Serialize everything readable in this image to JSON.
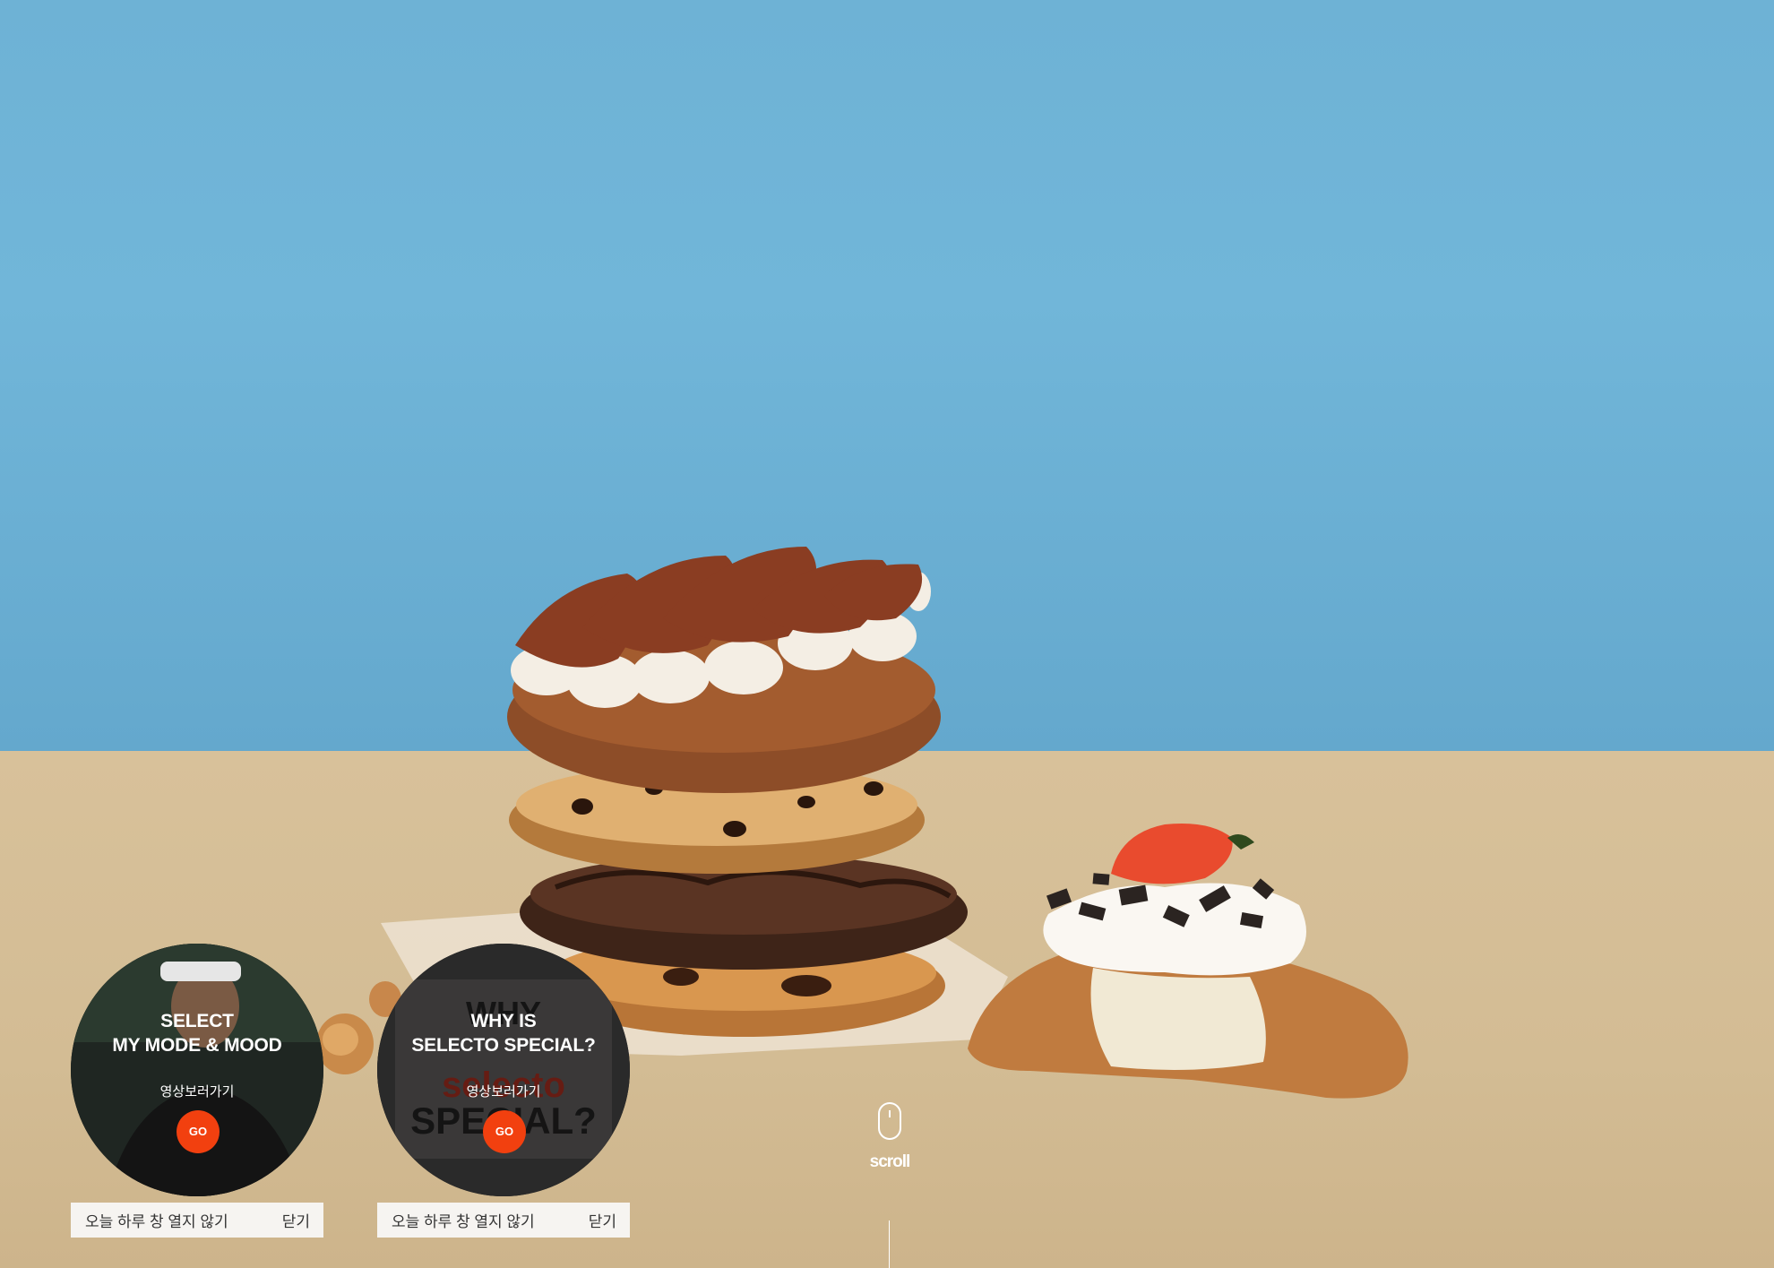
{
  "popups": [
    {
      "title_line1": "SELECT",
      "title_line2": "MY MODE & MOOD",
      "subtitle": "영상보러가기",
      "go_label": "GO",
      "dont_show_today": "오늘 하루 창 열지 않기",
      "close_label": "닫기"
    },
    {
      "title_line1": "WHY IS",
      "title_line2": "SELECTO SPECIAL?",
      "subtitle": "영상보러가기",
      "go_label": "GO",
      "dont_show_today": "오늘 하루 창 열지 않기",
      "close_label": "닫기",
      "background_text_line1": "WHY",
      "background_text_line2": "selecto",
      "background_text_line3": "SPECIAL?"
    }
  ],
  "scroll": {
    "label": "scroll"
  },
  "colors": {
    "wall": "#6eb2d5",
    "table": "#d6bf98",
    "accent_go": "#f2400f",
    "bar_bg": "#f6f4f1"
  }
}
